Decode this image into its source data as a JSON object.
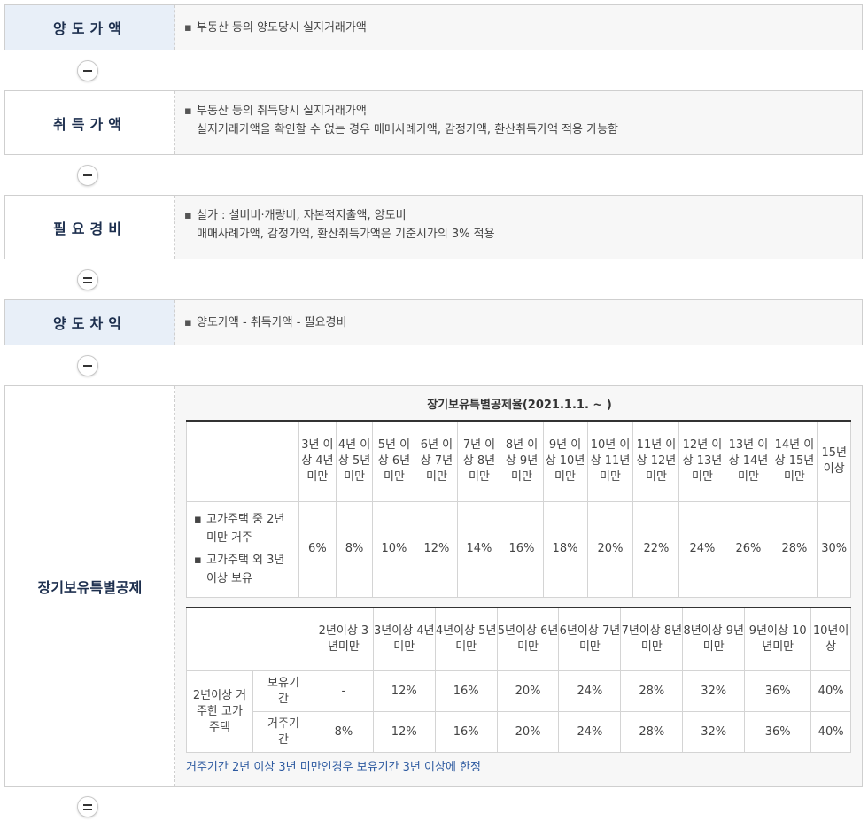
{
  "sections": {
    "transfer_price": {
      "label": "양도가액",
      "lines": [
        "부동산 등의 양도당시 실지거래가액"
      ]
    },
    "acquisition_price": {
      "label": "취득가액",
      "lines": [
        "부동산 등의 취득당시 실지거래가액",
        "실지거래가액을 확인할 수 없는 경우 매매사례가액, 감정가액, 환산취득가액 적용 가능함"
      ]
    },
    "expenses": {
      "label": "필요경비",
      "lines": [
        "실가 : 설비비·개량비, 자본적지출액, 양도비",
        "매매사례가액, 감정가액, 환산취득가액은 기준시가의 3% 적용"
      ]
    },
    "transfer_gain": {
      "label": "양도차익",
      "lines": [
        "양도가액 - 취득가액 - 필요경비"
      ]
    },
    "long_term": {
      "label": "장기보유특별공제"
    }
  },
  "operators": [
    "minus",
    "minus",
    "equals",
    "minus",
    "equals"
  ],
  "table1": {
    "title": "장기보유특별공제율(2021.1.1. ~ )",
    "headers": [
      "3년 이상 4년 미만",
      "4년 이상 5년 미만",
      "5년 이상 6년 미만",
      "6년 이상 7년 미만",
      "7년 이상 8년 미만",
      "8년 이상 9년 미만",
      "9년 이상 10년 미만",
      "10년 이상 11년 미만",
      "11년 이상 12년 미만",
      "12년 이상 13년 미만",
      "13년 이상 14년 미만",
      "14년 이상 15년 미만",
      "15년 이상"
    ],
    "row_labels": [
      "고가주택 중 2년 미만 거주",
      "고가주택 외 3년 이상 보유"
    ],
    "values": [
      "6%",
      "8%",
      "10%",
      "12%",
      "14%",
      "16%",
      "18%",
      "20%",
      "22%",
      "24%",
      "26%",
      "28%",
      "30%"
    ]
  },
  "table2": {
    "headers": [
      "2년이상 3년미만",
      "3년이상 4년미만",
      "4년이상 5년미만",
      "5년이상 6년미만",
      "6년이상 7년미만",
      "7년이상 8년미만",
      "8년이상 9년미만",
      "9년이상 10년미만",
      "10년이상"
    ],
    "group_label": "2년이상 거주한 고가주택",
    "rows": [
      {
        "label": "보유기간",
        "values": [
          "-",
          "12%",
          "16%",
          "20%",
          "24%",
          "28%",
          "32%",
          "36%",
          "40%"
        ]
      },
      {
        "label": "거주기간",
        "values": [
          "8%",
          "12%",
          "16%",
          "20%",
          "24%",
          "28%",
          "32%",
          "36%",
          "40%"
        ]
      }
    ],
    "note": "거주기간 2년 이상 3년 미만인경우 보유기간 3년 이상에 한정"
  }
}
